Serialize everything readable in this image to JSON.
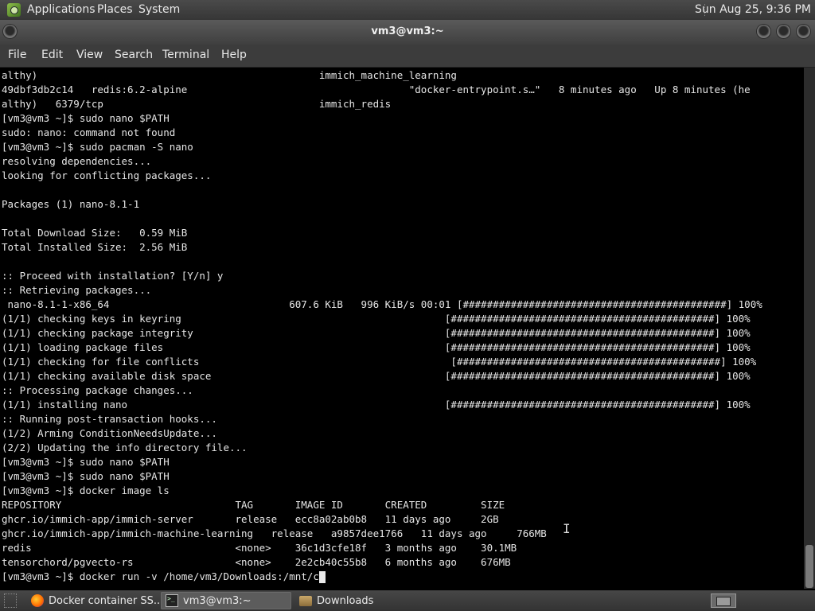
{
  "top_panel": {
    "menus": [
      "Applications",
      "Places",
      "System"
    ],
    "clock": "Sun Aug 25,  9:36 PM",
    "icon": "gnome-foot-icon"
  },
  "window": {
    "title": "vm3@vm3:~",
    "menu": [
      "File",
      "Edit",
      "View",
      "Search",
      "Terminal",
      "Help"
    ]
  },
  "terminal": {
    "lines": [
      "althy)                                               immich_machine_learning",
      "49dbf3db2c14   redis:6.2-alpine                                     \"docker-entrypoint.s…\"   8 minutes ago   Up 8 minutes (he",
      "althy)   6379/tcp                                    immich_redis",
      "[vm3@vm3 ~]$ sudo nano $PATH",
      "sudo: nano: command not found",
      "[vm3@vm3 ~]$ sudo pacman -S nano",
      "resolving dependencies...",
      "looking for conflicting packages...",
      "",
      "Packages (1) nano-8.1-1",
      "",
      "Total Download Size:   0.59 MiB",
      "Total Installed Size:  2.56 MiB",
      "",
      ":: Proceed with installation? [Y/n] y",
      ":: Retrieving packages...",
      " nano-8.1-1-x86_64                              607.6 KiB   996 KiB/s 00:01 [############################################] 100%",
      "(1/1) checking keys in keyring                                            [############################################] 100%",
      "(1/1) checking package integrity                                          [############################################] 100%",
      "(1/1) loading package files                                               [############################################] 100%",
      "(1/1) checking for file conflicts                                          [############################################] 100%",
      "(1/1) checking available disk space                                       [############################################] 100%",
      ":: Processing package changes...",
      "(1/1) installing nano                                                     [############################################] 100%",
      ":: Running post-transaction hooks...",
      "(1/2) Arming ConditionNeedsUpdate...",
      "(2/2) Updating the info directory file...",
      "[vm3@vm3 ~]$ sudo nano $PATH",
      "[vm3@vm3 ~]$ sudo nano $PATH",
      "[vm3@vm3 ~]$ docker image ls",
      "REPOSITORY                             TAG       IMAGE ID       CREATED         SIZE",
      "ghcr.io/immich-app/immich-server       release   ecc8a02ab0b8   11 days ago     2GB",
      "ghcr.io/immich-app/immich-machine-learning   release   a9857dee1766   11 days ago     766MB",
      "redis                                  <none>    36c1d3cfe18f   3 months ago    30.1MB",
      "tensorchord/pgvecto-rs                 <none>    2e2cb40c55b8   6 months ago    676MB",
      "[vm3@vm3 ~]$ docker run -v /home/vm3/Downloads:/mnt/c"
    ]
  },
  "taskbar": {
    "tasks": [
      {
        "label": "Docker container SS...",
        "icon": "firefox-icon"
      },
      {
        "label": "vm3@vm3:~",
        "icon": "terminal-icon"
      },
      {
        "label": "Downloads",
        "icon": "folder-icon"
      }
    ]
  }
}
